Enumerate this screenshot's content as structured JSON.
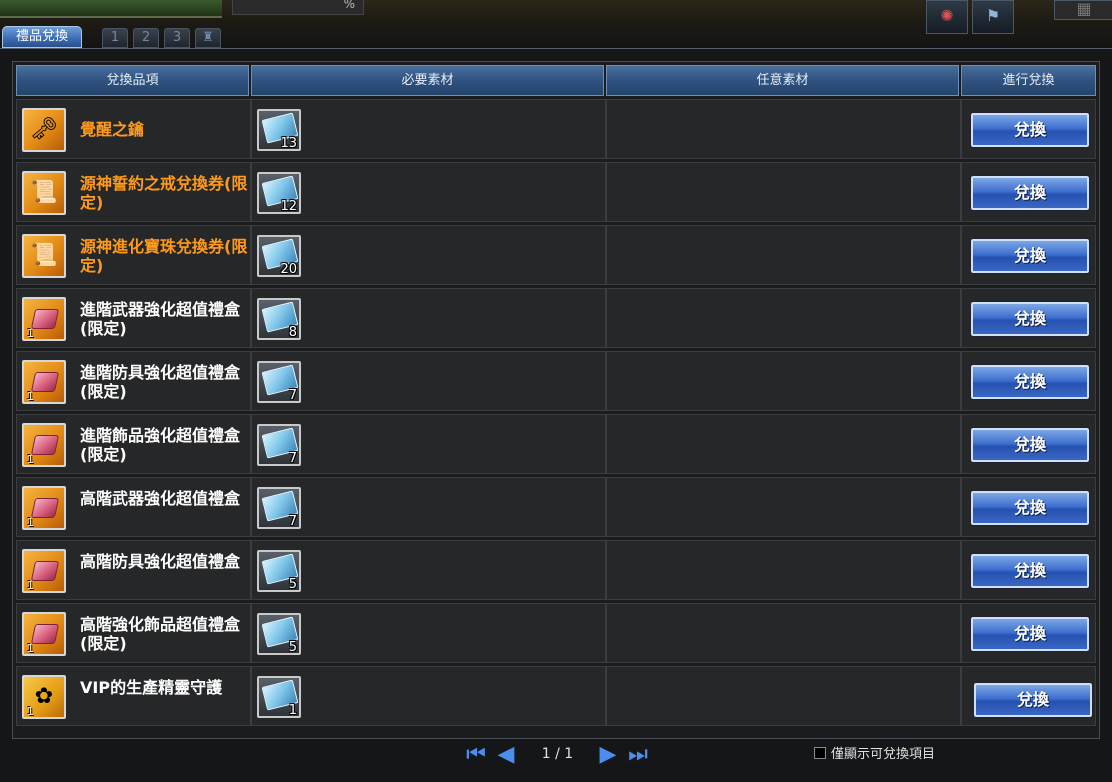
{
  "top_strip": {
    "percent_symbol": "%",
    "icons": [
      "compass-icon",
      "banner-icon",
      "calendar-icon"
    ]
  },
  "tabs": {
    "active_label": "禮品兌換",
    "numbers": [
      "1",
      "2",
      "3"
    ],
    "extra_icon": "trophy-icon"
  },
  "table": {
    "headers": [
      "兌換品項",
      "必要素材",
      "任意素材",
      "進行兌換"
    ],
    "rows": [
      {
        "name": "覺醒之鑰",
        "name_color": "#ff9a1a",
        "icon": "key-icon",
        "icon_qty": "",
        "material_qty": "13",
        "button": "兌換"
      },
      {
        "name": "源神誓約之戒兌換券(限定)",
        "name_color": "#ff9a1a",
        "icon": "scroll-icon",
        "icon_qty": "",
        "material_qty": "12",
        "button": "兌換"
      },
      {
        "name": "源神進化寶珠兌換券(限定)",
        "name_color": "#ff9a1a",
        "icon": "scroll-icon",
        "icon_qty": "",
        "material_qty": "20",
        "button": "兌換"
      },
      {
        "name": "進階武器強化超值禮盒(限定)",
        "name_color": "#ffffff",
        "icon": "giftbox-icon",
        "icon_qty": "1",
        "material_qty": "8",
        "button": "兌換"
      },
      {
        "name": "進階防具強化超值禮盒(限定)",
        "name_color": "#ffffff",
        "icon": "giftbox-icon",
        "icon_qty": "1",
        "material_qty": "7",
        "button": "兌換"
      },
      {
        "name": "進階飾品強化超值禮盒(限定)",
        "name_color": "#ffffff",
        "icon": "giftbox-icon",
        "icon_qty": "1",
        "material_qty": "7",
        "button": "兌換"
      },
      {
        "name": "高階武器強化超值禮盒",
        "name_color": "#ffffff",
        "icon": "giftbox-icon",
        "icon_qty": "1",
        "material_qty": "7",
        "button": "兌換"
      },
      {
        "name": "高階防具強化超值禮盒",
        "name_color": "#ffffff",
        "icon": "giftbox-icon",
        "icon_qty": "1",
        "material_qty": "5",
        "button": "兌換"
      },
      {
        "name": "高階強化飾品超值禮盒(限定)",
        "name_color": "#ffffff",
        "icon": "giftbox-icon",
        "icon_qty": "1",
        "material_qty": "5",
        "button": "兌換"
      },
      {
        "name": "VIP的生產精靈守護",
        "name_color": "#ffffff",
        "icon": "fairy-icon",
        "icon_qty": "1",
        "material_qty": "1",
        "button": "兌換"
      }
    ]
  },
  "pagination": {
    "current": "1 / 1"
  },
  "filter": {
    "checked": false,
    "label": "僅顯示可兌換項目"
  }
}
